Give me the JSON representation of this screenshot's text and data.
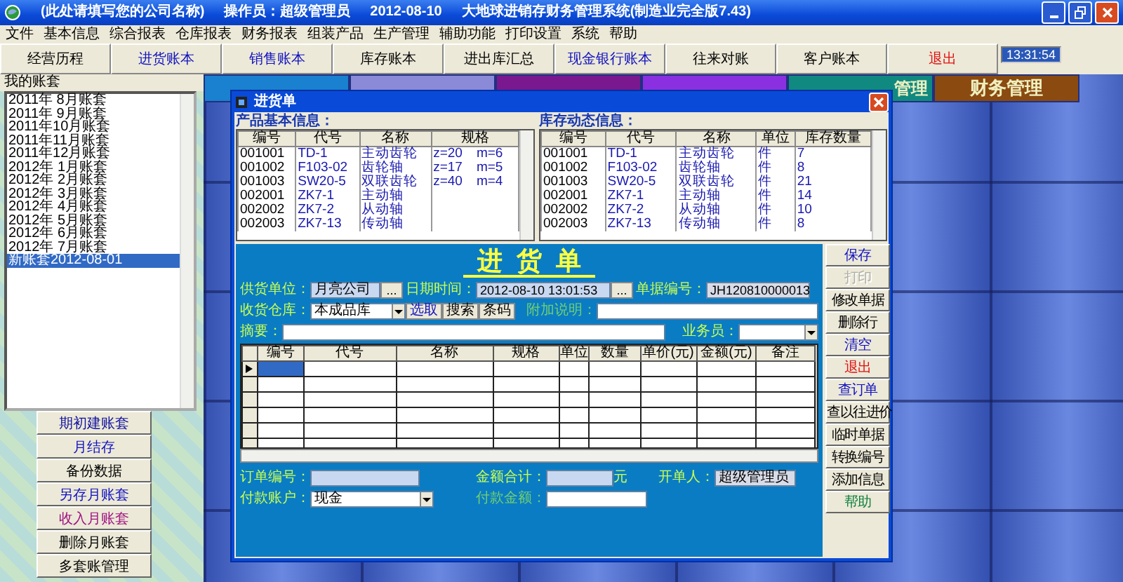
{
  "window": {
    "title_parts": [
      "(此处请填写您的公司名称)",
      "操作员：超级管理员",
      "2012-08-10",
      "大地球进销存财务管理系统(制造业完全版7.43)"
    ]
  },
  "menu": [
    "文件",
    "基本信息",
    "综合报表",
    "仓库报表",
    "财务报表",
    "组装产品",
    "生产管理",
    "辅助功能",
    "打印设置",
    "系统",
    "帮助"
  ],
  "toolbar": [
    {
      "label": "经营历程",
      "color": "#000000"
    },
    {
      "label": "进货账本",
      "color": "#1010c0"
    },
    {
      "label": "销售账本",
      "color": "#1010c0"
    },
    {
      "label": "库存账本",
      "color": "#000000"
    },
    {
      "label": "进出库汇总",
      "color": "#000000"
    },
    {
      "label": "现金银行账本",
      "color": "#1010c0"
    },
    {
      "label": "往来对账",
      "color": "#000000"
    },
    {
      "label": "客户账本",
      "color": "#000000"
    },
    {
      "label": "退出",
      "color": "#e01010"
    }
  ],
  "clock": "13:31:54",
  "accounts": {
    "title": "我的账套",
    "items": [
      {
        "label": "2011年 8月账套",
        "selected": false
      },
      {
        "label": "2011年 9月账套",
        "selected": false
      },
      {
        "label": "2011年10月账套",
        "selected": false
      },
      {
        "label": "2011年11月账套",
        "selected": false
      },
      {
        "label": "2011年12月账套",
        "selected": false
      },
      {
        "label": "2012年 1月账套",
        "selected": false
      },
      {
        "label": "2012年 2月账套",
        "selected": false
      },
      {
        "label": "2012年 3月账套",
        "selected": false
      },
      {
        "label": "2012年 4月账套",
        "selected": false
      },
      {
        "label": "2012年 5月账套",
        "selected": false
      },
      {
        "label": "2012年 6月账套",
        "selected": false
      },
      {
        "label": "2012年 7月账套",
        "selected": false
      },
      {
        "label": "新账套2012-08-01",
        "selected": true
      }
    ]
  },
  "account_buttons": [
    {
      "label": "期初建账套",
      "color": "#1010a0"
    },
    {
      "label": "月结存",
      "color": "#1010c0"
    },
    {
      "label": "备份数据",
      "color": "#000000"
    },
    {
      "label": "另存月账套",
      "color": "#1010c0"
    },
    {
      "label": "收入月账套",
      "color": "#a01080"
    },
    {
      "label": "删除月账套",
      "color": "#000000"
    },
    {
      "label": "多套账管理",
      "color": "#000000"
    }
  ],
  "module_tabs": [
    {
      "color": "#1a80d0"
    },
    {
      "color": "#8a8ad8"
    },
    {
      "color": "#7a1890"
    },
    {
      "color": "#8a30e0"
    },
    {
      "label": "管理",
      "color": "#108a80"
    },
    {
      "label": "财务管理",
      "color": "#8a4a10"
    }
  ],
  "dialog": {
    "title": "进货单",
    "product_info": {
      "caption": "产品基本信息：",
      "columns": [
        "编号",
        "代号",
        "名称",
        "规格"
      ],
      "rows": [
        [
          "001001",
          "TD-1",
          "主动齿轮",
          "z=20　m=6"
        ],
        [
          "001002",
          "F103-02",
          "齿轮轴",
          "z=17　m=5"
        ],
        [
          "001003",
          "SW20-5",
          "双联齿轮",
          "z=40　m=4"
        ],
        [
          "002001",
          "ZK7-1",
          "主动轴",
          ""
        ],
        [
          "002002",
          "ZK7-2",
          "从动轴",
          ""
        ],
        [
          "002003",
          "ZK7-13",
          "传动轴",
          ""
        ]
      ]
    },
    "stock_info": {
      "caption": "库存动态信息：",
      "columns": [
        "编号",
        "代号",
        "名称",
        "单位",
        "库存数量"
      ],
      "rows": [
        [
          "001001",
          "TD-1",
          "主动齿轮",
          "件",
          "7"
        ],
        [
          "001002",
          "F103-02",
          "齿轮轴",
          "件",
          "8"
        ],
        [
          "001003",
          "SW20-5",
          "双联齿轮",
          "件",
          "21"
        ],
        [
          "002001",
          "ZK7-1",
          "主动轴",
          "件",
          "14"
        ],
        [
          "002002",
          "ZK7-2",
          "从动轴",
          "件",
          "10"
        ],
        [
          "002003",
          "ZK7-13",
          "传动轴",
          "件",
          "8"
        ]
      ]
    },
    "form": {
      "heading": "进货单",
      "supplier": {
        "label": "供货单位：",
        "value": "月亮公司",
        "browse": "..."
      },
      "datetime": {
        "label": "日期时间：",
        "value": "2012-08-10 13:01:53",
        "browse": "..."
      },
      "doc_no": {
        "label": "单据编号：",
        "value": "JH120810000013"
      },
      "warehouse": {
        "label": "收货仓库：",
        "value": "本成品库"
      },
      "pick_buttons": [
        "选取",
        "搜索",
        "条码"
      ],
      "note": {
        "label": "附加说明："
      },
      "summary": {
        "label": "摘要："
      },
      "clerk": {
        "label": "业务员："
      },
      "grid": {
        "columns": [
          "编号",
          "代号",
          "名称",
          "规格",
          "单位",
          "数量",
          "单价(元)",
          "金额(元)",
          "备注"
        ],
        "rows": [
          {
            "current": true
          },
          {
            "current": false
          },
          {
            "current": false
          },
          {
            "current": false
          },
          {
            "current": false
          },
          {
            "current": false
          }
        ]
      },
      "order_no": {
        "label": "订单编号："
      },
      "total": {
        "label": "金额合计：",
        "unit": "元"
      },
      "maker": {
        "label": "开单人：",
        "value": "超级管理员"
      },
      "pay_account": {
        "label": "付款账户：",
        "value": "现金"
      },
      "pay_amount": {
        "label": "付款金额："
      }
    },
    "buttons": [
      {
        "label": "保存",
        "color": "#1010c0",
        "disabled": false
      },
      {
        "label": "打印",
        "color": "#b0b0a8",
        "disabled": true
      },
      {
        "label": "修改单据",
        "color": "#000000",
        "disabled": false
      },
      {
        "label": "删除行",
        "color": "#000000",
        "disabled": false
      },
      {
        "label": "清空",
        "color": "#1010c0",
        "disabled": false
      },
      {
        "label": "退出",
        "color": "#e01010",
        "disabled": false
      },
      {
        "label": "查订单",
        "color": "#1010c0",
        "disabled": false
      },
      {
        "label": "查以往进价",
        "color": "#000000",
        "disabled": false
      },
      {
        "label": "临时单据",
        "color": "#000000",
        "disabled": false
      },
      {
        "label": "转换编号",
        "color": "#000000",
        "disabled": false
      },
      {
        "label": "添加信息",
        "color": "#000000",
        "disabled": false
      },
      {
        "label": "帮助",
        "color": "#108040",
        "disabled": false
      }
    ]
  }
}
